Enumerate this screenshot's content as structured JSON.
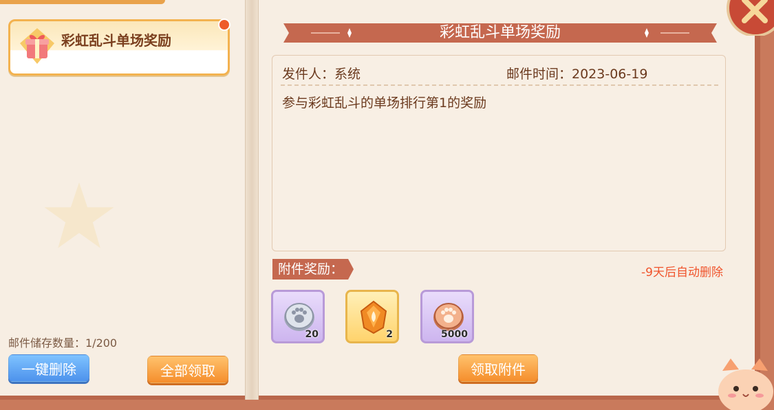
{
  "mail_list": {
    "items": [
      {
        "title": "彩虹乱斗单场奖励",
        "icon": "gift-icon",
        "unread": true
      }
    ],
    "storage_text": "邮件储存数量：1/200"
  },
  "buttons": {
    "delete_all": "一键删除",
    "claim_all": "全部领取",
    "claim_attachment": "领取附件"
  },
  "mail_detail": {
    "title": "彩虹乱斗单场奖励",
    "sender": "发件人：系统",
    "time": "邮件时间：2023-06-19",
    "content": "参与彩虹乱斗的单场排行第1的奖励"
  },
  "attachments": {
    "label": "附件奖励：",
    "auto_delete": "-9天后自动删除",
    "items": [
      {
        "icon": "silver-paw-coin-icon",
        "count": "20"
      },
      {
        "icon": "orange-crystal-icon",
        "count": "2"
      },
      {
        "icon": "bronze-paw-coin-icon",
        "count": "5000"
      }
    ]
  },
  "colors": {
    "accent_red": "#c5684f",
    "auto_delete": "#f0542c",
    "button_blue": "#4d92ec",
    "button_orange": "#f58e2c"
  }
}
